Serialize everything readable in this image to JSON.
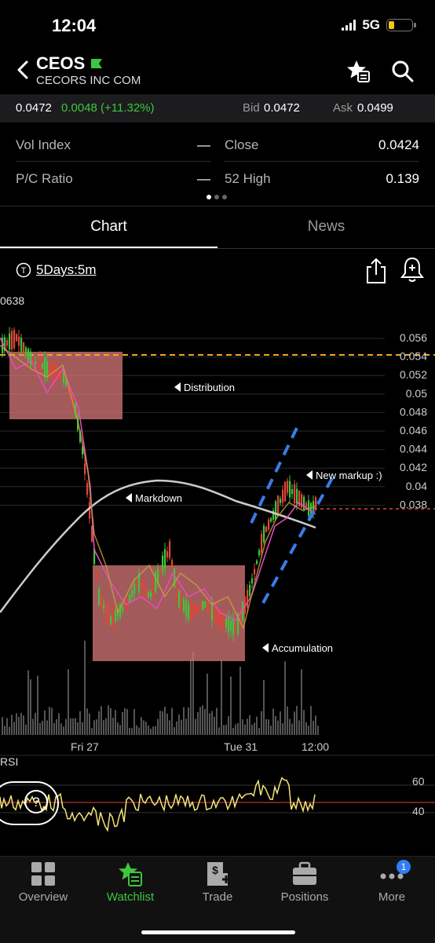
{
  "status": {
    "time": "12:04",
    "network": "5G"
  },
  "header": {
    "ticker": "CEOS",
    "company": "CECORS INC COM"
  },
  "quote": {
    "last": "0.0472",
    "change": "0.0048 (+11.32%)",
    "bid_label": "Bid",
    "bid": "0.0472",
    "ask_label": "Ask",
    "ask": "0.0499"
  },
  "stats": {
    "vol_index_label": "Vol Index",
    "vol_index_value": "—",
    "close_label": "Close",
    "close_value": "0.0424",
    "pc_ratio_label": "P/C Ratio",
    "pc_ratio_value": "—",
    "high52_label": "52 High",
    "high52_value": "0.139"
  },
  "tabs": {
    "chart": "Chart",
    "news": "News"
  },
  "period": "5Days:5m",
  "chart": {
    "top_left_label": "0638",
    "y_ticks": [
      "0.056",
      "0.054",
      "0.052",
      "0.05",
      "0.048",
      "0.046",
      "0.044",
      "0.042",
      "0.04",
      "0.038"
    ],
    "x_ticks": [
      "Fri 27",
      "Tue 31",
      "12:00"
    ],
    "annotations": {
      "distribution": "Distribution",
      "markdown": "Markdown",
      "accumulation": "Accumulation",
      "markup": "New markup :)"
    },
    "rsi_label": "RSI",
    "rsi_ticks": [
      "60",
      "40"
    ]
  },
  "nav": {
    "overview": "Overview",
    "watchlist": "Watchlist",
    "trade": "Trade",
    "positions": "Positions",
    "more": "More",
    "more_badge": "1"
  },
  "colors": {
    "accent": "#3ec63e",
    "down": "#e0453a",
    "zone": "#d9787a",
    "channel": "#3a7be8",
    "resistance": "#f5a623"
  }
}
